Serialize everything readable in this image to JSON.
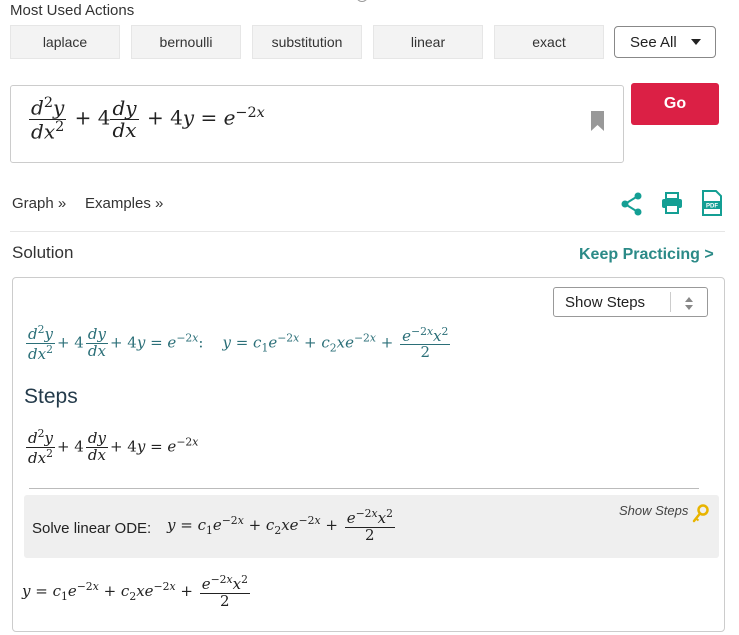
{
  "actions": {
    "title": "Most Used Actions",
    "items": [
      "laplace",
      "bernoulli",
      "substitution",
      "linear",
      "exact"
    ],
    "see_all": "See All"
  },
  "input": {
    "expression": "d^2y/dx^2 + 4 dy/dx + 4y = e^(-2x)",
    "go": "Go"
  },
  "links": {
    "graph": "Graph »",
    "examples": "Examples »"
  },
  "solution": {
    "label": "Solution",
    "keep_practicing": "Keep Practicing >",
    "show_steps_select": "Show Steps",
    "result": "y = c_1 e^(-2x) + c_2 x e^(-2x) + e^(-2x) x^2 / 2",
    "steps_heading": "Steps",
    "step_title": "Solve linear ODE:",
    "step_show_steps": "Show Steps"
  },
  "colors": {
    "go": "#db2045",
    "accent": "#2b8a87",
    "icon": "#149f94"
  },
  "icons": [
    "share-icon",
    "print-icon",
    "pdf-icon",
    "bookmark-icon",
    "key-icon"
  ]
}
